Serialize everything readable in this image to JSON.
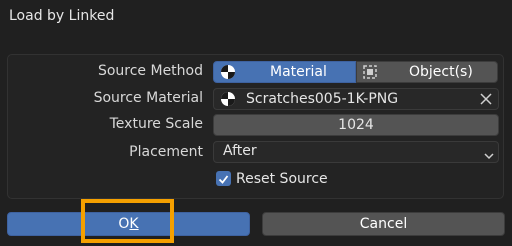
{
  "dialog": {
    "title": "Load by Linked"
  },
  "rows": {
    "source_method": {
      "label": "Source Method",
      "options": [
        "Material",
        "Object(s)"
      ],
      "selected": "Material"
    },
    "source_material": {
      "label": "Source Material",
      "value": "Scratches005-1K-PNG"
    },
    "texture_scale": {
      "label": "Texture Scale",
      "value": "1024"
    },
    "placement": {
      "label": "Placement",
      "value": "After"
    },
    "reset_source": {
      "label": "Reset Source",
      "checked": true
    }
  },
  "buttons": {
    "ok_prefix": "O",
    "ok_underlined": "K",
    "cancel": "Cancel"
  },
  "icons": {
    "material_icon": "material-sphere-icon",
    "object_icon": "object-icon",
    "clear_icon": "close-icon",
    "dropdown_icon": "chevron-down-icon",
    "check_icon": "checkmark-icon"
  },
  "colors": {
    "accent": "#4772b3",
    "highlight": "#f5a000",
    "background": "#202020",
    "field": "#545454"
  }
}
